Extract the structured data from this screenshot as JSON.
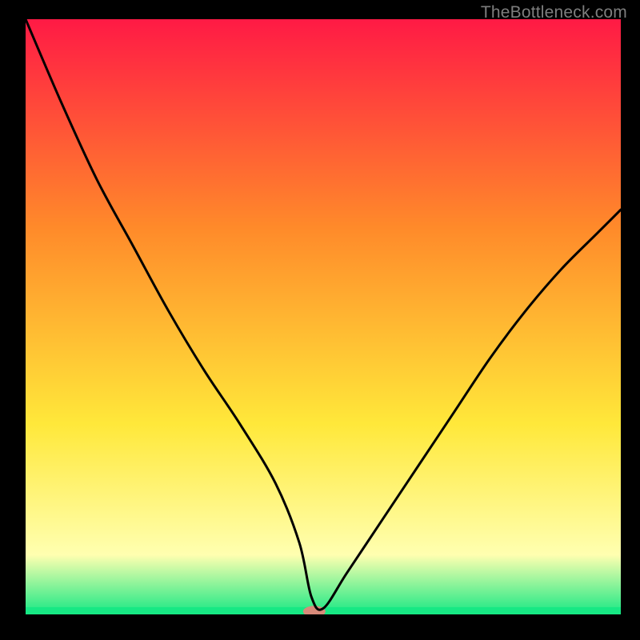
{
  "watermark": "TheBottleneck.com",
  "chart_data": {
    "type": "line",
    "title": "",
    "xlabel": "",
    "ylabel": "",
    "xlim": [
      0,
      100
    ],
    "ylim": [
      0,
      100
    ],
    "background_gradient": {
      "top": "#ff1a45",
      "mid1": "#ff8a2a",
      "mid2": "#ffe83a",
      "low": "#ffffb0",
      "bottom": "#17e884"
    },
    "curve": {
      "x": [
        0,
        6,
        12,
        18,
        24,
        30,
        36,
        42,
        46,
        48,
        50,
        54,
        60,
        66,
        72,
        78,
        84,
        90,
        96,
        100
      ],
      "y": [
        100,
        86,
        73,
        62,
        51,
        41,
        32,
        22,
        12,
        3,
        1,
        7,
        16,
        25,
        34,
        43,
        51,
        58,
        64,
        68
      ]
    },
    "marker": {
      "x": 48.5,
      "y": 0.5,
      "color": "#d88a7a",
      "rx": 14,
      "ry": 7
    }
  }
}
